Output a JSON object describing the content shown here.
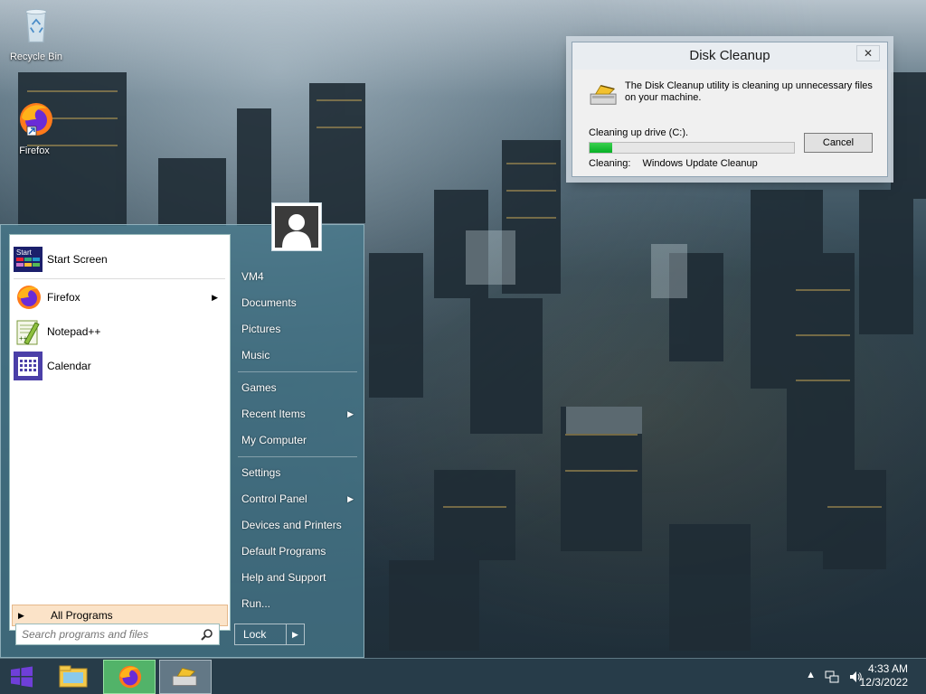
{
  "desktop": {
    "icons": [
      {
        "label": "Recycle Bin",
        "icon": "recycle-bin-icon"
      },
      {
        "label": "Firefox",
        "icon": "firefox-icon"
      }
    ]
  },
  "dialog": {
    "title": "Disk Cleanup",
    "close_label": "✕",
    "message": "The Disk Cleanup utility is cleaning up unnecessary files on your machine.",
    "drive_text": "Cleaning up drive  (C:).",
    "progress_fraction": 0.11,
    "cancel_label": "Cancel",
    "cleaning_label": "Cleaning:",
    "cleaning_value": "Windows Update Cleanup"
  },
  "start_menu": {
    "programs": [
      {
        "label": "Start Screen",
        "icon": "start-screen-icon",
        "has_submenu": false
      },
      {
        "label": "Firefox",
        "icon": "firefox-icon",
        "has_submenu": true
      },
      {
        "label": "Notepad++",
        "icon": "notepad-plus-plus-icon",
        "has_submenu": false
      },
      {
        "label": "Calendar",
        "icon": "calendar-icon",
        "has_submenu": false
      }
    ],
    "start_screen_badge": "Start",
    "all_programs_label": "All Programs",
    "search_placeholder": "Search programs and files",
    "right_items": {
      "group1": [
        "VM4",
        "Documents",
        "Pictures",
        "Music"
      ],
      "group2": [
        "Games",
        "Recent Items",
        "My Computer"
      ],
      "group3": [
        "Settings",
        "Control Panel",
        "Devices and Printers",
        "Default Programs",
        "Help and Support",
        "Run..."
      ]
    },
    "lock_label": "Lock"
  },
  "taskbar": {
    "time": "4:33 AM",
    "date": "12/3/2022",
    "tray_icons": [
      "show-hidden-icons-icon",
      "network-icon",
      "volume-icon"
    ]
  }
}
